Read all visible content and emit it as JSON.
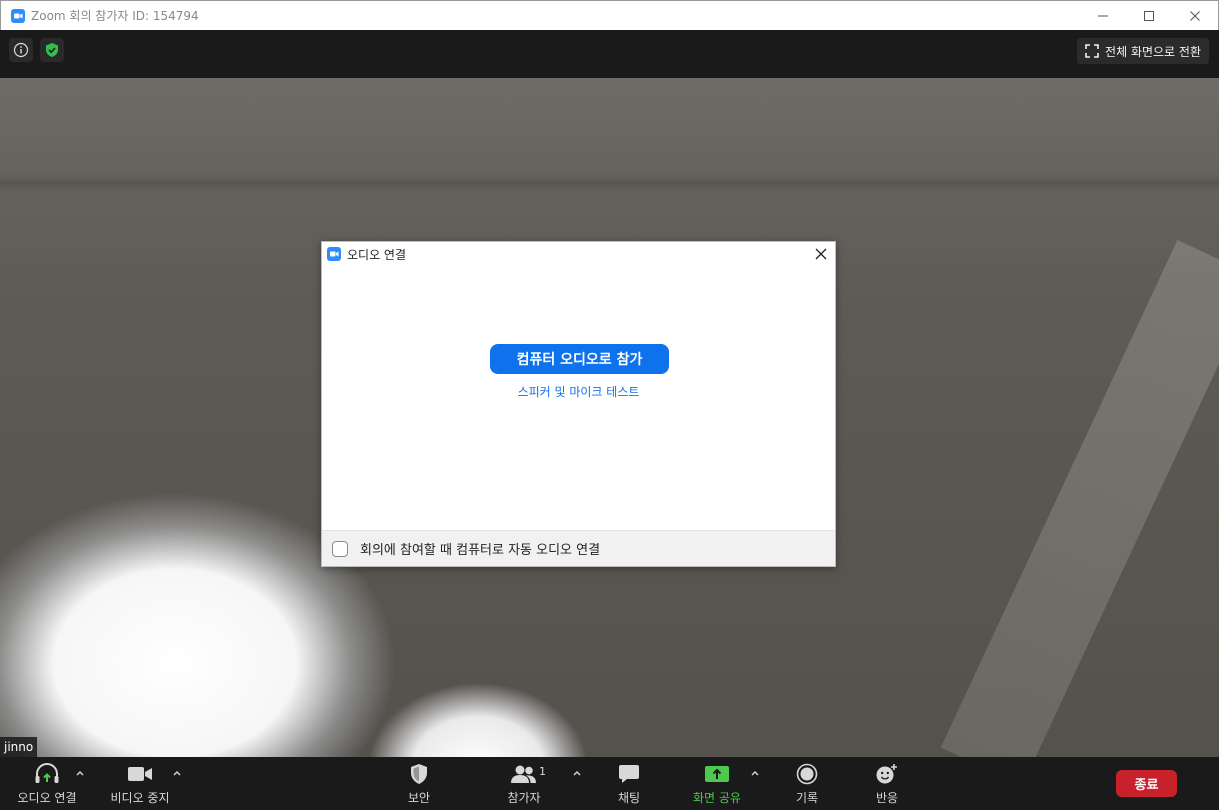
{
  "window": {
    "title": "Zoom 회의 참가자 ID: 154794"
  },
  "topbar": {
    "fullscreen_label": "전체 화면으로 전환"
  },
  "video": {
    "participant_name": "jinno"
  },
  "dialog": {
    "title": "오디오 연결",
    "join_button": "컴퓨터 오디오로 참가",
    "test_link": "스피커 및 마이크 테스트",
    "auto_join_label": "회의에 참여할 때 컴퓨터로 자동 오디오 연결",
    "auto_join_checked": false
  },
  "toolbar": {
    "audio": "오디오 연결",
    "video": "비디오 중지",
    "security": "보안",
    "participants": "참가자",
    "participants_count": "1",
    "chat": "채팅",
    "share": "화면 공유",
    "record": "기록",
    "reactions": "반응",
    "end": "종료"
  },
  "colors": {
    "accent_blue": "#0e72ed",
    "share_green": "#4ec94e",
    "end_red": "#c8212b",
    "shield_green": "#2ec24b"
  }
}
